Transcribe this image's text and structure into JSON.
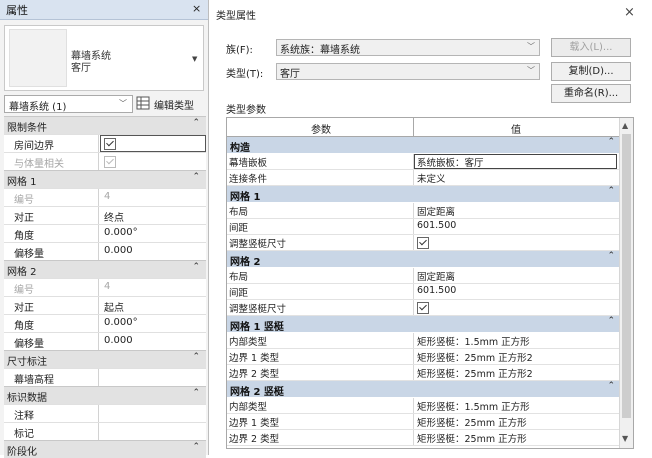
{
  "properties": {
    "title": "属性",
    "close": "×",
    "preview": {
      "family": "幕墙系统",
      "type": "客厅",
      "caret": "▼"
    },
    "selector": {
      "text": "幕墙系统 (1)",
      "caret": "﹀"
    },
    "edit_type": "编辑类型",
    "groups": [
      {
        "label": "限制条件",
        "collapse": "⌃",
        "rows": [
          {
            "name": "房间边界",
            "value": "",
            "checkbox": true,
            "disabled": false,
            "highlight": true
          },
          {
            "name": "与体量相关",
            "value": "",
            "checkbox": true,
            "disabled": true,
            "highlight": false
          }
        ]
      },
      {
        "label": "网格 1",
        "collapse": "⌃",
        "rows": [
          {
            "name": "编号",
            "value": "4",
            "checkbox": false,
            "disabled": true
          },
          {
            "name": "对正",
            "value": "终点",
            "checkbox": false,
            "disabled": false
          },
          {
            "name": "角度",
            "value": "0.000°",
            "checkbox": false,
            "disabled": false
          },
          {
            "name": "偏移量",
            "value": "0.000",
            "checkbox": false,
            "disabled": false
          }
        ]
      },
      {
        "label": "网格 2",
        "collapse": "⌃",
        "rows": [
          {
            "name": "编号",
            "value": "4",
            "checkbox": false,
            "disabled": true
          },
          {
            "name": "对正",
            "value": "起点",
            "checkbox": false,
            "disabled": false
          },
          {
            "name": "角度",
            "value": "0.000°",
            "checkbox": false,
            "disabled": false
          },
          {
            "name": "偏移量",
            "value": "0.000",
            "checkbox": false,
            "disabled": false
          }
        ]
      },
      {
        "label": "尺寸标注",
        "collapse": "⌃",
        "rows": [
          {
            "name": "幕墙高程",
            "value": "",
            "checkbox": false,
            "disabled": false
          }
        ]
      },
      {
        "label": "标识数据",
        "collapse": "⌃",
        "rows": [
          {
            "name": "注释",
            "value": "",
            "checkbox": false,
            "disabled": false
          },
          {
            "name": "标记",
            "value": "",
            "checkbox": false,
            "disabled": false
          }
        ]
      },
      {
        "label": "阶段化",
        "collapse": "⌃",
        "rows": []
      }
    ]
  },
  "dialog": {
    "title": "类型属性",
    "close": "×",
    "family_label": "族(F):",
    "family_value": "系统族：幕墙系统",
    "type_label": "类型(T):",
    "type_value": "客厅",
    "load_button": "载入(L)...",
    "duplicate_button": "复制(D)...",
    "rename_button": "重命名(R)...",
    "type_params_label": "类型参数",
    "col_param": "参数",
    "col_value": "值",
    "caret": "﹀",
    "groups": [
      {
        "label": "构造",
        "collapse": "⌃",
        "rows": [
          {
            "name": "幕墙嵌板",
            "value": "系统嵌板：客厅",
            "checkbox": false,
            "highlight": true
          },
          {
            "name": "连接条件",
            "value": "未定义",
            "checkbox": false
          }
        ]
      },
      {
        "label": "网格 1",
        "collapse": "⌃",
        "rows": [
          {
            "name": "布局",
            "value": "固定距离",
            "checkbox": false
          },
          {
            "name": "间距",
            "value": "601.500",
            "checkbox": false
          },
          {
            "name": "调整竖梃尺寸",
            "value": "",
            "checkbox": true
          }
        ]
      },
      {
        "label": "网格 2",
        "collapse": "⌃",
        "rows": [
          {
            "name": "布局",
            "value": "固定距离",
            "checkbox": false
          },
          {
            "name": "间距",
            "value": "601.500",
            "checkbox": false
          },
          {
            "name": "调整竖梃尺寸",
            "value": "",
            "checkbox": true
          }
        ]
      },
      {
        "label": "网格 1 竖梃",
        "collapse": "⌃",
        "rows": [
          {
            "name": "内部类型",
            "value": "矩形竖梃：1.5mm 正方形",
            "checkbox": false
          },
          {
            "name": "边界 1 类型",
            "value": "矩形竖梃：25mm 正方形2",
            "checkbox": false
          },
          {
            "name": "边界 2 类型",
            "value": "矩形竖梃：25mm 正方形2",
            "checkbox": false
          }
        ]
      },
      {
        "label": "网格 2 竖梃",
        "collapse": "⌃",
        "rows": [
          {
            "name": "内部类型",
            "value": "矩形竖梃：1.5mm 正方形",
            "checkbox": false
          },
          {
            "name": "边界 1 类型",
            "value": "矩形竖梃：25mm 正方形",
            "checkbox": false
          },
          {
            "name": "边界 2 类型",
            "value": "矩形竖梃：25mm 正方形",
            "checkbox": false
          }
        ]
      }
    ],
    "scroll_up": "▲",
    "scroll_down": "▼"
  }
}
